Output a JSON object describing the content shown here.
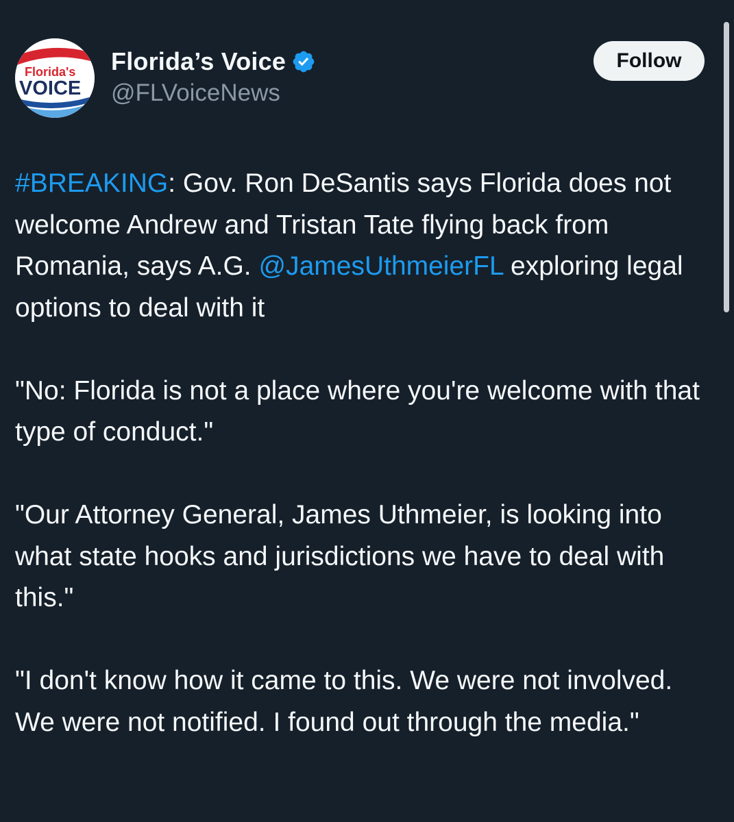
{
  "account": {
    "display_name": "Florida’s Voice",
    "handle": "@FLVoiceNews",
    "avatar": {
      "logo_top": "Florida's",
      "logo_bottom": "VOICE"
    }
  },
  "follow_button": {
    "label": "Follow"
  },
  "tweet": {
    "p1": {
      "hashtag": "#BREAKING",
      "text_a": ": Gov. Ron DeSantis says Florida does not welcome Andrew and Tristan Tate flying back from Romania, says A.G. ",
      "mention": "@JamesUthmeierFL",
      "text_b": " exploring legal options to deal with it"
    },
    "p2": "\"No: Florida is not a place where you're welcome with that type of conduct.\"",
    "p3": "\"Our Attorney General, James Uthmeier, is looking into what state hooks and jurisdictions we have to deal with this.\"",
    "p4": "\"I don't know how it came to this. We were not involved. We were not notified. I found out through the media.\""
  },
  "colors": {
    "background": "#16202a",
    "link": "#1d9bf0",
    "verified_badge": "#1d9bf0",
    "secondary_text": "#8b98a5"
  },
  "icons": {
    "verified": "verified-badge-icon"
  }
}
